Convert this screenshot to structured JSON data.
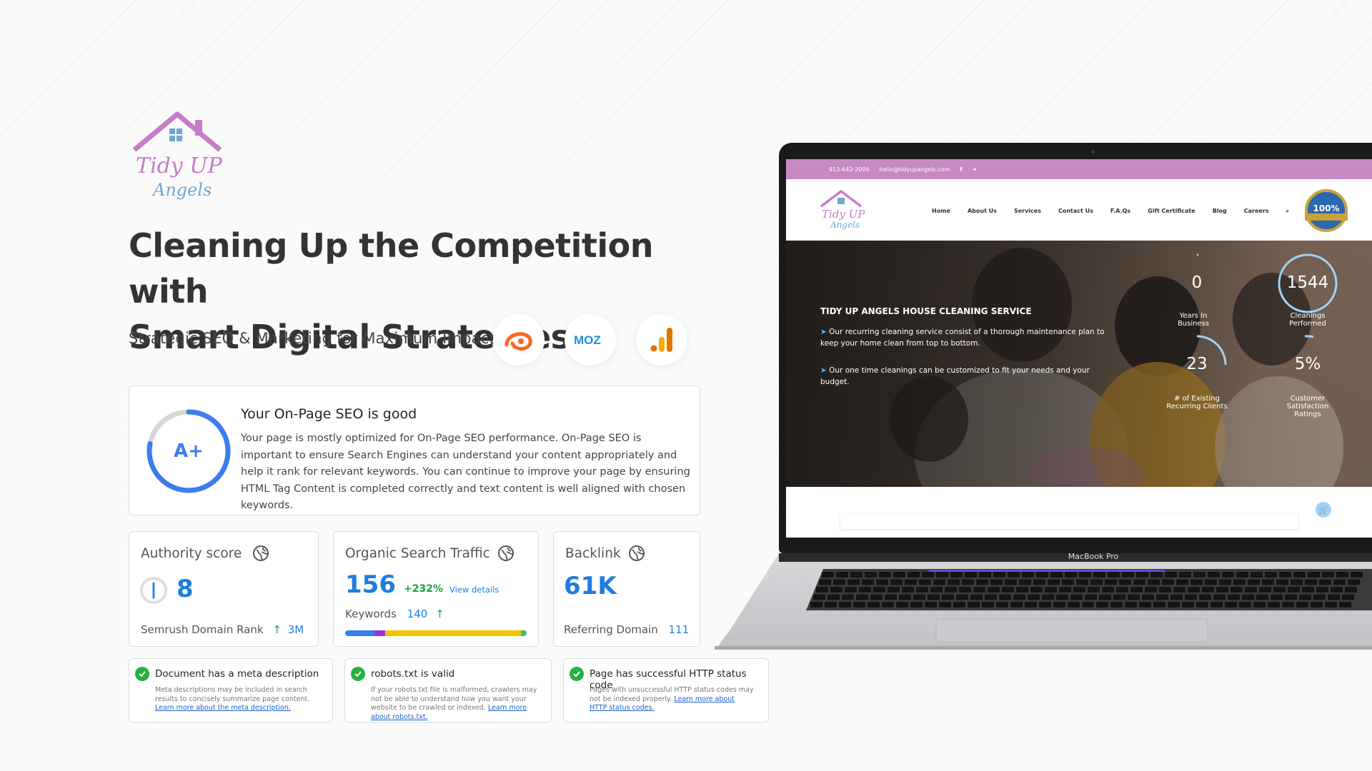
{
  "brand": {
    "logo_line1": "Tidy UP",
    "logo_line2": "Angels"
  },
  "headline": {
    "line1": "Cleaning Up the Competition with",
    "line2": "Smart Digital Strategies"
  },
  "subhead": "Strategic SEO & Marketing for Maximum Impact.",
  "tools": [
    {
      "name": "semrush",
      "icon": "semrush-logo-icon"
    },
    {
      "name": "MOZ",
      "icon": "moz-logo-icon"
    },
    {
      "name": "analytics",
      "icon": "google-analytics-icon"
    }
  ],
  "seo_card": {
    "grade": "A+",
    "score_fraction": 0.78,
    "title": "Your On-Page SEO is good",
    "body": "Your page is mostly optimized for On-Page SEO performance. On-Page SEO is important to ensure Search Engines can understand your content appropriately and help it rank for relevant keywords. You can continue to improve your page by ensuring HTML Tag Content is completed correctly and text content is well aligned with chosen keywords."
  },
  "authority": {
    "title": "Authority score",
    "value": "8",
    "rank_label": "Semrush Domain Rank",
    "rank_arrow": "↑",
    "rank_value": "3M"
  },
  "organic": {
    "title": "Organic Search Traffic",
    "value": "156",
    "change": "+232%",
    "link": "View details",
    "keywords_label": "Keywords",
    "keywords_value": "140",
    "keywords_arrow": "↑",
    "bar_segments": [
      {
        "color": "#2f80ed",
        "fraction": 0.16
      },
      {
        "color": "#a22fd6",
        "fraction": 0.06
      },
      {
        "color": "#f5c400",
        "fraction": 0.75
      },
      {
        "color": "#3bc46a",
        "fraction": 0.03
      }
    ]
  },
  "backlink": {
    "title": "Backlink",
    "value": "61K",
    "ref_label": "Referring Domain",
    "ref_value": "111"
  },
  "checks": [
    {
      "title": "Document has a meta description",
      "body": "Meta descriptions may be included in search results to concisely summarize page content.",
      "link": "Learn more about the meta description."
    },
    {
      "title": "robots.txt is valid",
      "body": "If your robots.txt file is malformed, crawlers may not be able to understand how you want your website to be crawled or indexed.",
      "link": "Learn more about robots.txt."
    },
    {
      "title": "Page has successful HTTP status code",
      "body": "Pages with unsuccessful HTTP status codes may not be indexed properly.",
      "link": "Learn more about HTTP status codes."
    }
  ],
  "laptop": {
    "model": "MacBook Pro",
    "site": {
      "phone": "913-642-2006",
      "email": "hello@tidyupangels.com",
      "nav": [
        "Home",
        "About Us",
        "Services",
        "Contact Us",
        "F.A.Qs",
        "Gift Certificate",
        "Blog",
        "Careers"
      ],
      "badge_text": "100%",
      "hero_title": "TIDY UP ANGELS HOUSE CLEANING SERVICE",
      "bullet1": "Our recurring cleaning service consist of a thorough maintenance plan to keep your home clean from top to bottom.",
      "bullet2": "Our one time cleanings can be customized to fit your needs and your budget.",
      "stats": [
        {
          "value": "0",
          "label": "Years In Business"
        },
        {
          "value": "1544",
          "label": "Cleanings Performed"
        },
        {
          "value": "23",
          "label": "# of Existing Recurring Clients"
        },
        {
          "value": "5%",
          "label": "Customer Satisfaction Ratings"
        }
      ]
    }
  },
  "colors": {
    "accent_blue": "#1f7de0",
    "grade_blue": "#3b7cf0",
    "check_green": "#27b042",
    "site_pink": "#c689c2"
  }
}
